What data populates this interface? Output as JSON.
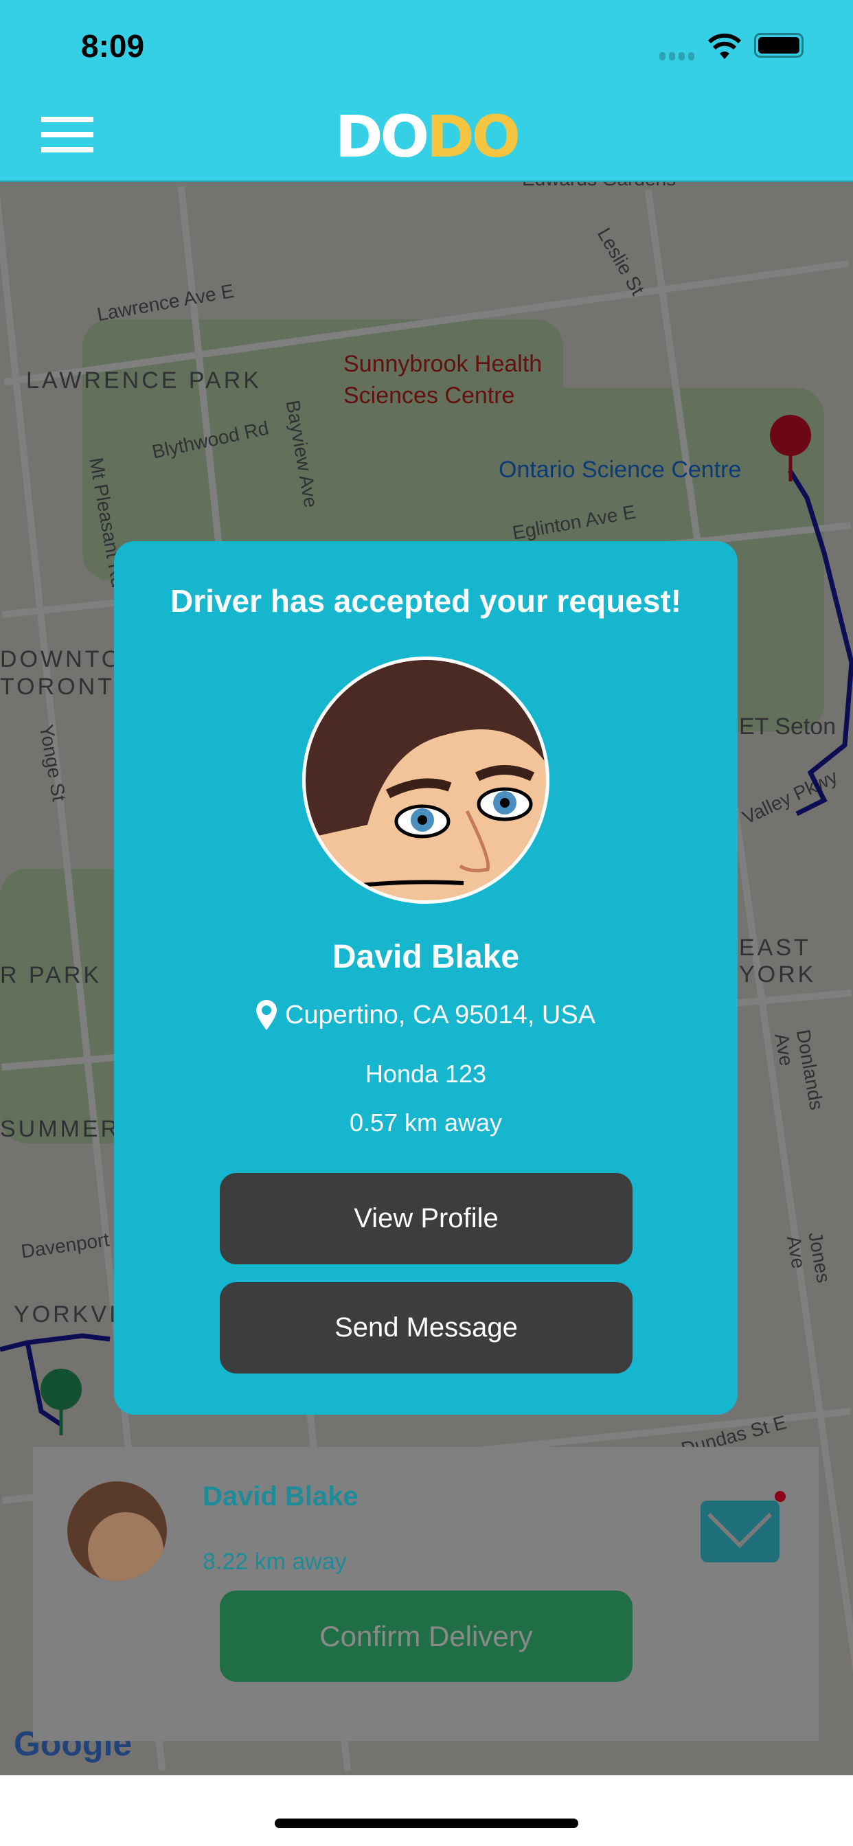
{
  "status_bar": {
    "time": "8:09"
  },
  "header": {
    "logo_part1": "DO",
    "logo_part2": "DO",
    "menu_icon": "hamburger-icon"
  },
  "map": {
    "labels": [
      "Edwards Gardens",
      "Lawrence Ave E",
      "LAWRENCE PARK",
      "Sunnybrook Health",
      "Sciences Centre",
      "Blythwood Rd",
      "Bayview Ave",
      "Mt Pleasant Rd",
      "Ontario Science Centre",
      "Eglinton Ave E",
      "Leslie St",
      "DOWNTOWN",
      "TORONTO",
      "Yonge St",
      "ET Seton",
      "Valley Pkwy",
      "EAST YORK",
      "R PARK",
      "SUMMERHILL",
      "Donlands Ave",
      "Davenport Rd",
      "YORKVILLE",
      "Jones Ave",
      "Dundas St E"
    ],
    "attribution": "Google"
  },
  "modal": {
    "title": "Driver has accepted your request!",
    "driver_name": "David Blake",
    "location": "Cupertino, CA 95014, USA",
    "vehicle": "Honda 123",
    "distance": "0.57 km away",
    "view_profile": "View Profile",
    "send_message": "Send Message"
  },
  "bottom_card": {
    "driver_name": "David Blake",
    "distance": "8.22 km away",
    "confirm_delivery": "Confirm Delivery",
    "unread_indicator": true
  },
  "colors": {
    "header": "#36d0e6",
    "modal": "#16b6cf",
    "button": "#3d3d3d",
    "confirm": "#27a061",
    "logo_accent": "#f5c542"
  }
}
